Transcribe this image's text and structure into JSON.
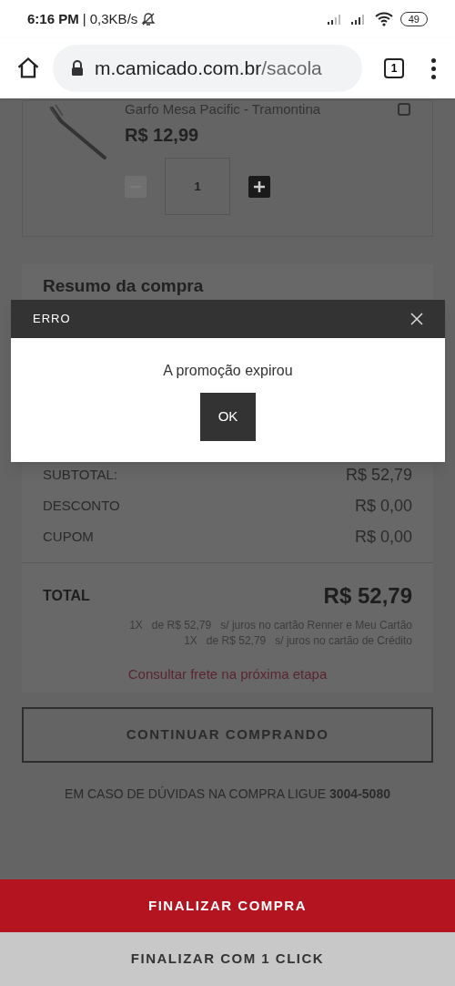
{
  "status_bar": {
    "time": "6:16 PM",
    "speed": "| 0,3KB/s",
    "battery": "49"
  },
  "browser": {
    "url_host": "m.camicado.com.br",
    "url_path": "/sacola",
    "tab_count": "1"
  },
  "cart_item": {
    "name": "Garfo Mesa Pacific - Tramontina",
    "price": "R$ 12,99",
    "quantity": "1",
    "decrease_disabled": true
  },
  "summary": {
    "title": "Resumo da compra",
    "rows": [
      {
        "label": "SUBTOTAL:",
        "value": "R$ 52,79"
      },
      {
        "label": "DESCONTO",
        "value": "R$ 0,00"
      },
      {
        "label": "CUPOM",
        "value": "R$ 0,00"
      }
    ],
    "total_label": "TOTAL",
    "total_value": "R$ 52,79",
    "installments": [
      {
        "count": "1X",
        "text": "de R$ 52,79",
        "note": "s/ juros no cartão Renner e Meu Cartão"
      },
      {
        "count": "1X",
        "text": "de R$ 52,79",
        "note": "s/ juros no cartão de Crédito"
      }
    ],
    "shipping_note": "Consultar frete na próxima etapa"
  },
  "continue_button": "CONTINUAR COMPRANDO",
  "help_text": "EM CASO DE DÚVIDAS NA COMPRA LIGUE **3004-5080**",
  "finalize_button": "FINALIZAR COMPRA",
  "one_click_button": "FINALIZAR COM 1 CLICK",
  "dialog": {
    "title": "ERRO",
    "message": "A promoção expirou",
    "ok": "OK"
  }
}
